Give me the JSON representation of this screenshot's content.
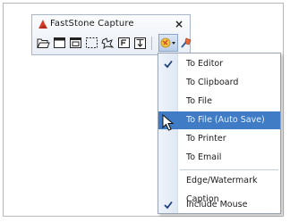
{
  "window": {
    "title": "FastStone Capture",
    "close_label": "×"
  },
  "toolbar": {
    "buttons": [
      "open-file-icon",
      "capture-window-icon",
      "capture-object-icon",
      "capture-rectangle-icon",
      "capture-freehand-icon",
      "capture-fullscreen-icon",
      "capture-scrolling-icon",
      "output-destination-icon",
      "settings-icon"
    ]
  },
  "menu": {
    "items": [
      {
        "label": "To Editor",
        "checked": true
      },
      {
        "label": "To Clipboard",
        "checked": false
      },
      {
        "label": "To File",
        "checked": false
      },
      {
        "label": "To File (Auto Save)",
        "checked": false,
        "highlighted": true
      },
      {
        "label": "To Printer",
        "checked": false
      },
      {
        "label": "To Email",
        "checked": false
      },
      {
        "label": "Edge/Watermark",
        "checked": false
      },
      {
        "label": "Caption",
        "checked": false
      },
      {
        "label": "Include Mouse",
        "checked": true
      }
    ]
  },
  "colors": {
    "highlight": "#3f7cc5",
    "menu_strip": "#e4ecf6",
    "check": "#1e3f7a"
  }
}
